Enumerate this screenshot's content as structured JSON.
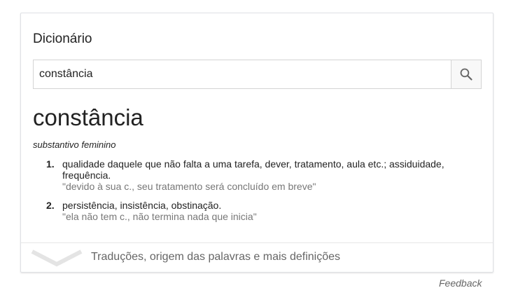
{
  "card": {
    "title": "Dicionário",
    "search": {
      "value": "constância",
      "icon": "search-icon"
    },
    "headword": "constância",
    "part_of_speech": "substantivo feminino",
    "definitions": [
      {
        "number": "1.",
        "text": "qualidade daquele que não falta a uma tarefa, dever, tratamento, aula etc.; assiduidade, frequência.",
        "example": "\"devido à sua c., seu tratamento será concluído em breve\""
      },
      {
        "number": "2.",
        "text": "persistência, insistência, obstinação.",
        "example": "\"ela não tem c., não termina nada que inicia\""
      }
    ],
    "more_link": "Traduções, origem das palavras e mais definições",
    "more_icon": "chevron-down-icon"
  },
  "feedback": "Feedback",
  "colors": {
    "text": "#222222",
    "muted": "#777777",
    "border": "#dfe1e5"
  }
}
